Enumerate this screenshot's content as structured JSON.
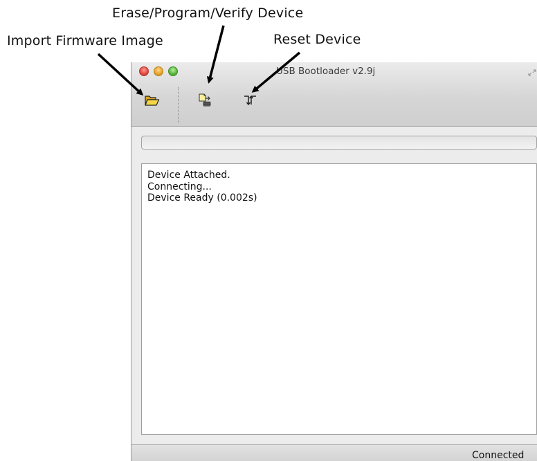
{
  "annotations": {
    "import_firmware_image": "Import Firmware Image",
    "erase_program_verify_device": "Erase/Program/Verify Device",
    "reset_device": "Reset Device"
  },
  "window": {
    "title": "USB Bootloader v2.9j"
  },
  "toolbar": {
    "buttons": [
      {
        "name": "import-firmware",
        "icon": "open-folder-icon"
      },
      {
        "name": "erase-program-verify",
        "icon": "chip-program-icon"
      },
      {
        "name": "reset-device",
        "icon": "reset-signal-icon"
      }
    ]
  },
  "progress": {
    "value": 0
  },
  "log": {
    "lines": [
      "Device Attached.",
      "Connecting...",
      "Device Ready (0.002s)"
    ]
  },
  "status": {
    "text": "Connected"
  },
  "colors": {
    "close": "#e0443e",
    "minimize": "#e6a12a",
    "zoom": "#58b43c",
    "folder": "#e9c33b"
  }
}
